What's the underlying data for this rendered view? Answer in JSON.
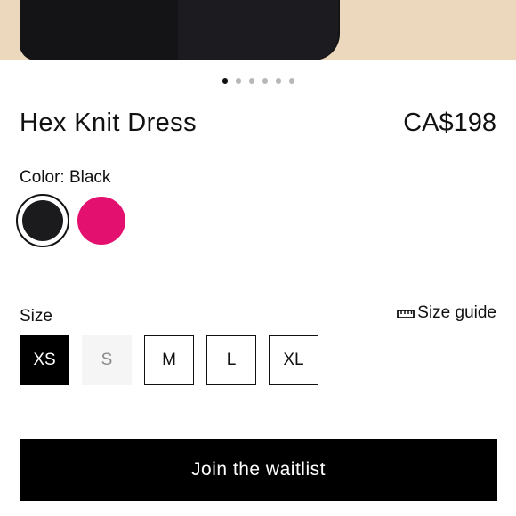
{
  "product": {
    "title": "Hex Knit Dress",
    "price": "CA$198"
  },
  "gallery": {
    "total_images": 6,
    "active_index": 0
  },
  "color": {
    "label": "Color: Black",
    "options": [
      {
        "name": "Black",
        "hex": "#1b1b1d",
        "selected": true
      },
      {
        "name": "Pink",
        "hex": "#e3106f",
        "selected": false
      }
    ]
  },
  "size": {
    "label": "Size",
    "guide_label": "Size guide",
    "guide_icon": "ruler-icon",
    "options": [
      {
        "label": "XS",
        "state": "selected"
      },
      {
        "label": "S",
        "state": "unavailable"
      },
      {
        "label": "M",
        "state": "available"
      },
      {
        "label": "L",
        "state": "available"
      },
      {
        "label": "XL",
        "state": "available"
      }
    ]
  },
  "cta": {
    "label": "Join the waitlist"
  },
  "colors": {
    "background": "#ffffff",
    "text": "#111111",
    "hero_background": "#ecd9bd",
    "cta_background": "#000000"
  }
}
